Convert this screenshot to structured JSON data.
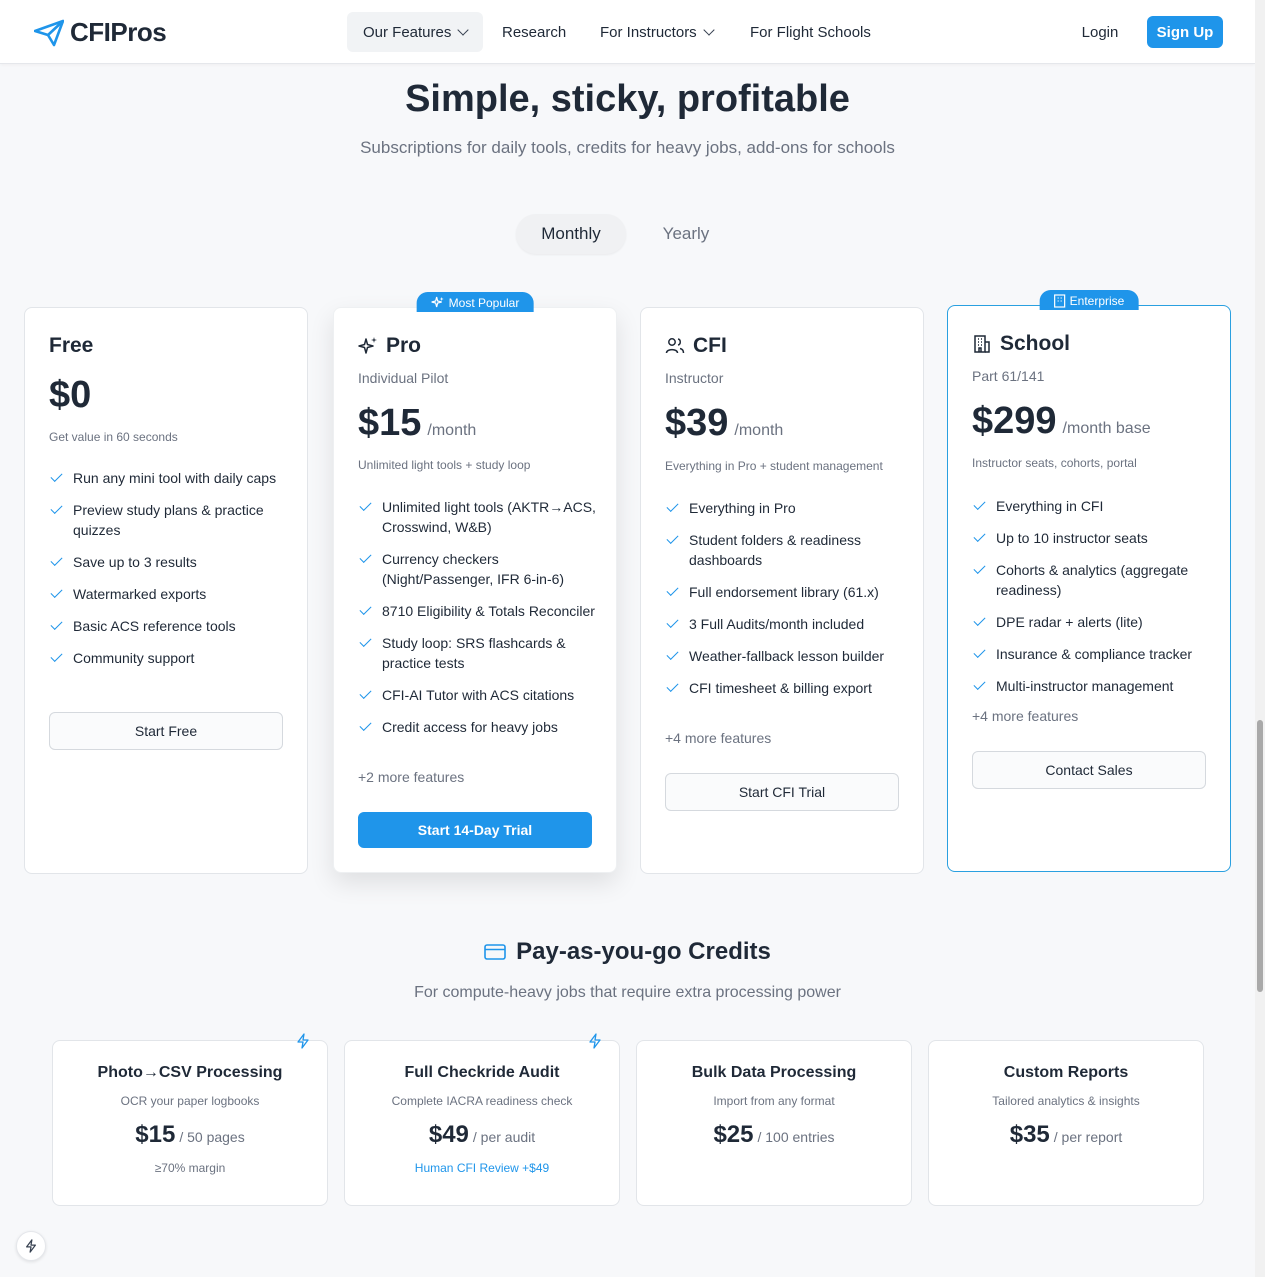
{
  "nav": {
    "logo": "CFIPros",
    "links": [
      {
        "label": "Our Features"
      },
      {
        "label": "Research"
      },
      {
        "label": "For Instructors"
      },
      {
        "label": "For Flight Schools"
      }
    ],
    "login": "Login",
    "signup": "Sign Up"
  },
  "hero": {
    "title": "Simple, sticky, profitable",
    "subtitle": "Subscriptions for daily tools, credits for heavy jobs, add-ons for schools"
  },
  "billing_toggle": {
    "monthly": "Monthly",
    "yearly": "Yearly",
    "selected": "Monthly"
  },
  "plans": [
    {
      "name": "Free",
      "price": "$0",
      "desc": "Get value in 60 seconds",
      "features": [
        "Run any mini tool with daily caps",
        "Preview study plans & practice quizzes",
        "Save up to 3 results",
        "Watermarked exports",
        "Basic ACS reference tools",
        "Community support"
      ],
      "cta": "Start Free"
    },
    {
      "name": "Pro",
      "badge": "Most Popular",
      "subtitle": "Individual Pilot",
      "price": "$15",
      "period": "/month",
      "desc": "Unlimited light tools + study loop",
      "features": [
        "Unlimited light tools (AKTR→ACS, Crosswind, W&B)",
        "Currency checkers (Night/Passenger, IFR 6-in-6)",
        "8710 Eligibility & Totals Reconciler",
        "Study loop: SRS flashcards & practice tests",
        "CFI-AI Tutor with ACS citations",
        "Credit access for heavy jobs"
      ],
      "more": "+2 more features",
      "cta": "Start 14-Day Trial"
    },
    {
      "name": "CFI",
      "subtitle": "Instructor",
      "price": "$39",
      "period": "/month",
      "desc": "Everything in Pro + student management",
      "features": [
        "Everything in Pro",
        "Student folders & readiness dashboards",
        "Full endorsement library (61.x)",
        "3 Full Audits/month included",
        "Weather-fallback lesson builder",
        "CFI timesheet & billing export"
      ],
      "more": "+4 more features",
      "cta": "Start CFI Trial"
    },
    {
      "name": "School",
      "badge": "Enterprise",
      "subtitle": "Part 61/141",
      "price": "$299",
      "period": "/month base",
      "desc": "Instructor seats, cohorts, portal",
      "features": [
        "Everything in CFI",
        "Up to 10 instructor seats",
        "Cohorts & analytics (aggregate readiness)",
        "DPE radar + alerts (lite)",
        "Insurance & compliance tracker",
        "Multi-instructor management"
      ],
      "more": "+4 more features",
      "cta": "Contact Sales"
    }
  ],
  "credits": {
    "title": "Pay-as-you-go Credits",
    "subtitle": "For compute-heavy jobs that require extra processing power",
    "items": [
      {
        "title": "Photo→CSV Processing",
        "desc": "OCR your paper logbooks",
        "price": "$15",
        "unit": "/ 50 pages",
        "note": "≥70% margin",
        "bolt": true
      },
      {
        "title": "Full Checkride Audit",
        "desc": "Complete IACRA readiness check",
        "price": "$49",
        "unit": "/ per audit",
        "note": "Human CFI Review +$49",
        "bolt": true
      },
      {
        "title": "Bulk Data Processing",
        "desc": "Import from any format",
        "price": "$25",
        "unit": "/ 100 entries",
        "note": ""
      },
      {
        "title": "Custom Reports",
        "desc": "Tailored analytics & insights",
        "price": "$35",
        "unit": "/ per report",
        "note": ""
      }
    ]
  },
  "colors": {
    "accent": "#1f95ea",
    "text": "#1f2937",
    "muted": "#6b7280",
    "background": "#f7f8fa"
  }
}
